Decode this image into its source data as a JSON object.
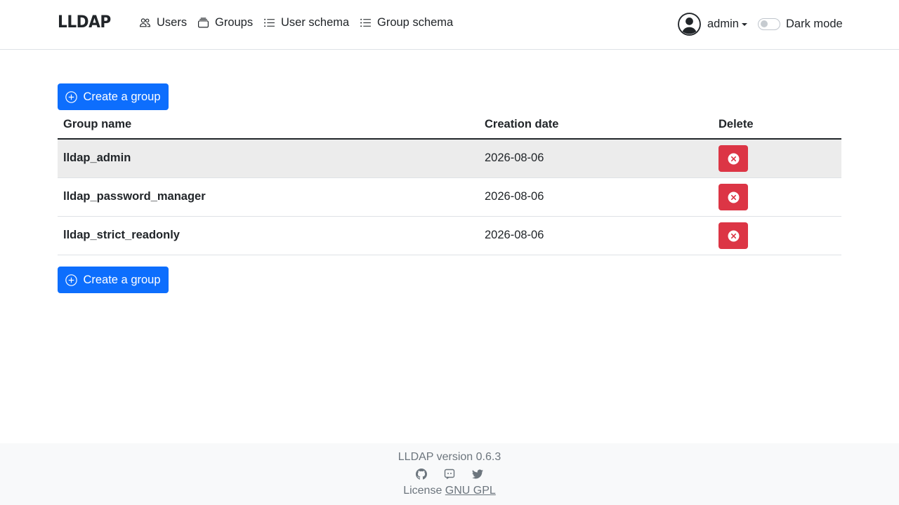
{
  "brand": "LLDAP",
  "nav": {
    "users": "Users",
    "groups": "Groups",
    "user_schema": "User schema",
    "group_schema": "Group schema"
  },
  "user_menu": {
    "username": "admin"
  },
  "dark_mode": {
    "label": "Dark mode",
    "enabled": false
  },
  "actions": {
    "create_group": "Create a group"
  },
  "table": {
    "headers": {
      "name": "Group name",
      "date": "Creation date",
      "delete": "Delete"
    },
    "rows": [
      {
        "name": "lldap_admin",
        "date": "2026-08-06"
      },
      {
        "name": "lldap_password_manager",
        "date": "2026-08-06"
      },
      {
        "name": "lldap_strict_readonly",
        "date": "2026-08-06"
      }
    ]
  },
  "footer": {
    "version": "LLDAP version 0.6.3",
    "license_prefix": "License",
    "license_link": "GNU GPL",
    "icons": [
      "github-icon",
      "discord-icon",
      "twitter-icon"
    ]
  },
  "colors": {
    "primary": "#0d6efd",
    "danger": "#dc3545",
    "footer_bg": "#f8f9fa",
    "row_hover": "#ececec"
  }
}
